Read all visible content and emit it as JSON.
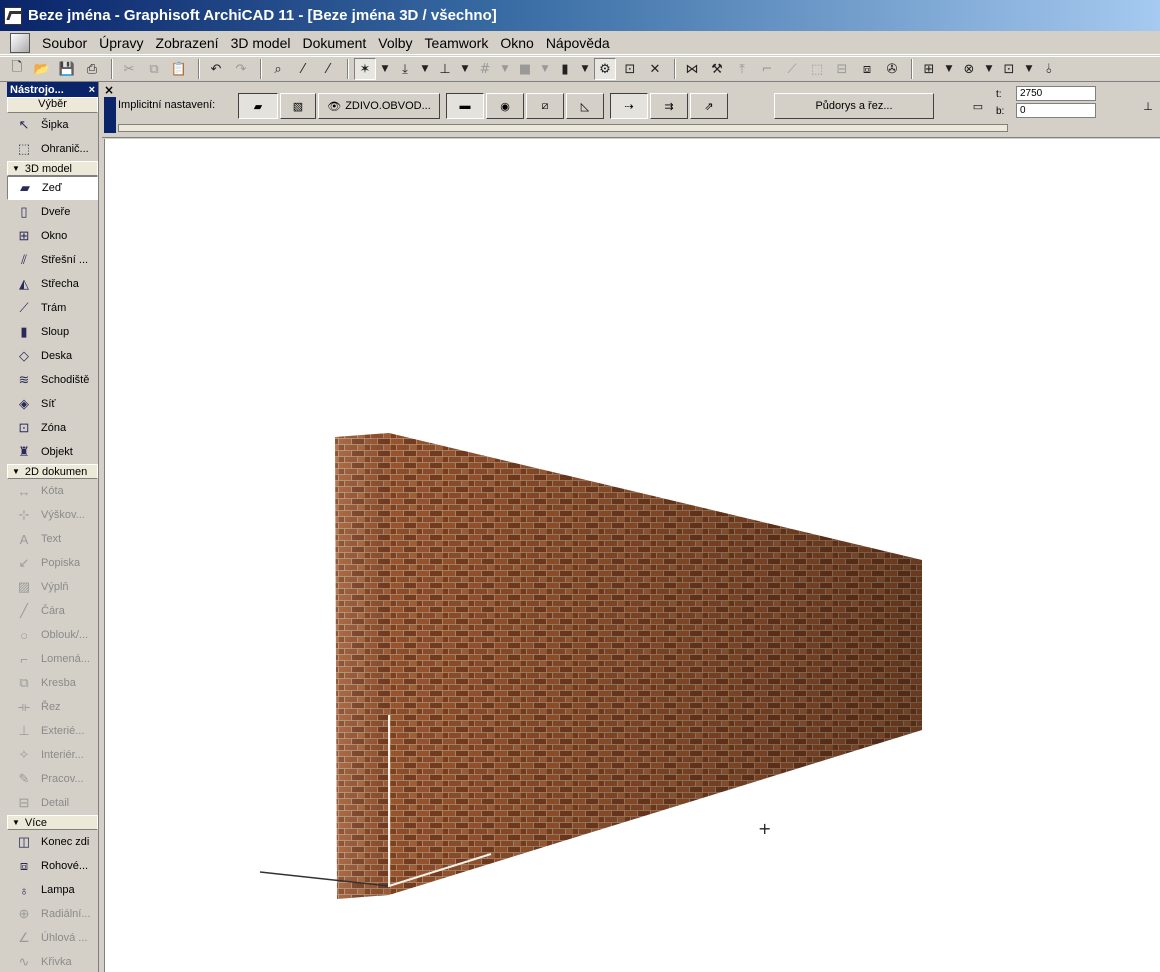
{
  "window": {
    "title": "Beze jména - Graphisoft ArchiCAD 11 - [Beze jména 3D / všechno]"
  },
  "menu": [
    "Soubor",
    "Úpravy",
    "Zobrazení",
    "3D model",
    "Dokument",
    "Volby",
    "Teamwork",
    "Okno",
    "Nápověda"
  ],
  "palette": {
    "title": "Nástrojo...",
    "close": "×",
    "select": "Výběr",
    "top_tools": [
      {
        "label": "Šipka",
        "icon": "arrow-icon"
      },
      {
        "label": "Ohranič...",
        "icon": "marquee-icon"
      }
    ],
    "sections": [
      {
        "label": "3D model",
        "tools": [
          {
            "label": "Zeď",
            "icon": "wall-icon",
            "selected": true
          },
          {
            "label": "Dveře",
            "icon": "door-icon"
          },
          {
            "label": "Okno",
            "icon": "window-icon"
          },
          {
            "label": "Střešní ...",
            "icon": "roof-window-icon"
          },
          {
            "label": "Střecha",
            "icon": "roof-icon"
          },
          {
            "label": "Trám",
            "icon": "beam-icon"
          },
          {
            "label": "Sloup",
            "icon": "column-icon"
          },
          {
            "label": "Deska",
            "icon": "slab-icon"
          },
          {
            "label": "Schodiště",
            "icon": "stair-icon"
          },
          {
            "label": "Síť",
            "icon": "mesh-icon"
          },
          {
            "label": "Zóna",
            "icon": "zone-icon"
          },
          {
            "label": "Objekt",
            "icon": "object-icon"
          }
        ]
      },
      {
        "label": "2D dokumen",
        "tools": [
          {
            "label": "Kóta",
            "icon": "dimension-icon",
            "disabled": true
          },
          {
            "label": "Výškov...",
            "icon": "level-dimension-icon",
            "disabled": true
          },
          {
            "label": "Text",
            "icon": "text-icon",
            "disabled": true
          },
          {
            "label": "Popiska",
            "icon": "label-icon",
            "disabled": true
          },
          {
            "label": "Výplň",
            "icon": "fill-icon",
            "disabled": true
          },
          {
            "label": "Čára",
            "icon": "line-icon",
            "disabled": true
          },
          {
            "label": "Oblouk/...",
            "icon": "arc-icon",
            "disabled": true
          },
          {
            "label": "Lomená...",
            "icon": "polyline-icon",
            "disabled": true
          },
          {
            "label": "Kresba",
            "icon": "drawing-icon",
            "disabled": true
          },
          {
            "label": "Řez",
            "icon": "section-icon",
            "disabled": true
          },
          {
            "label": "Exterié...",
            "icon": "elevation-icon",
            "disabled": true
          },
          {
            "label": "Interiér...",
            "icon": "interior-icon",
            "disabled": true
          },
          {
            "label": "Pracov...",
            "icon": "worksheet-icon",
            "disabled": true
          },
          {
            "label": "Detail",
            "icon": "detail-icon",
            "disabled": true
          }
        ]
      },
      {
        "label": "Více",
        "tools": [
          {
            "label": "Konec zdi",
            "icon": "wall-end-icon"
          },
          {
            "label": "Rohové...",
            "icon": "corner-window-icon"
          },
          {
            "label": "Lampa",
            "icon": "lamp-icon"
          },
          {
            "label": "Radiální...",
            "icon": "radial-dimension-icon",
            "disabled": true
          },
          {
            "label": "Úhlová ...",
            "icon": "angle-dimension-icon",
            "disabled": true
          },
          {
            "label": "Křivka",
            "icon": "curve-icon",
            "disabled": true
          }
        ]
      }
    ]
  },
  "infobox": {
    "close": "×",
    "label": "Implicitní nastavení:",
    "composite": "ZDIVO.OBVOD...",
    "floorplan_button": "Půdorys a řez...",
    "top_label": "t:",
    "top_value": "2750",
    "bottom_label": "b:",
    "bottom_value": "0"
  },
  "colors": {
    "title_start": "#0a246a",
    "title_end": "#a6caf0",
    "chrome": "#d4d0c8",
    "brick_dark": "#5e3218",
    "brick_light": "#a45d35"
  }
}
